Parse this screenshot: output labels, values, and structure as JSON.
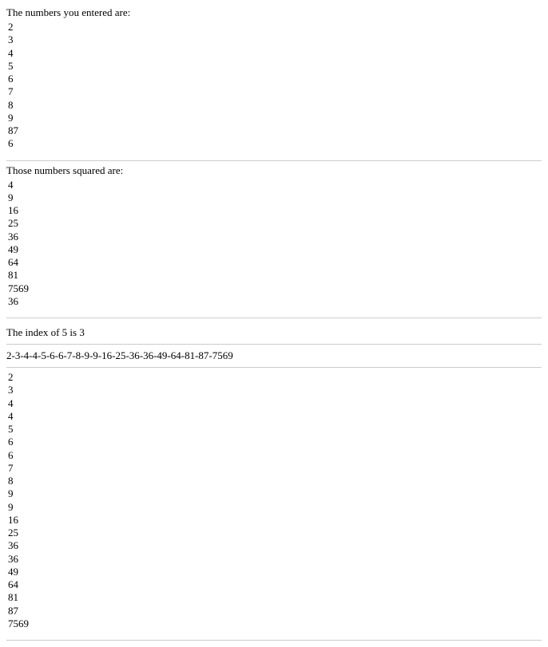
{
  "section1": {
    "heading": "The numbers you entered are:",
    "values": [
      "2",
      "3",
      "4",
      "5",
      "6",
      "7",
      "8",
      "9",
      "87",
      "6"
    ]
  },
  "section2": {
    "heading": "Those numbers squared are:",
    "values": [
      "4",
      "9",
      "16",
      "25",
      "36",
      "49",
      "64",
      "81",
      "7569",
      "36"
    ]
  },
  "section3": {
    "text": "The index of 5 is 3"
  },
  "section4": {
    "text": "2-3-4-4-5-6-6-7-8-9-9-16-25-36-36-49-64-81-87-7569"
  },
  "section5": {
    "values": [
      "2",
      "3",
      "4",
      "4",
      "5",
      "6",
      "6",
      "7",
      "8",
      "9",
      "9",
      "16",
      "25",
      "36",
      "36",
      "49",
      "64",
      "81",
      "87",
      "7569"
    ]
  }
}
